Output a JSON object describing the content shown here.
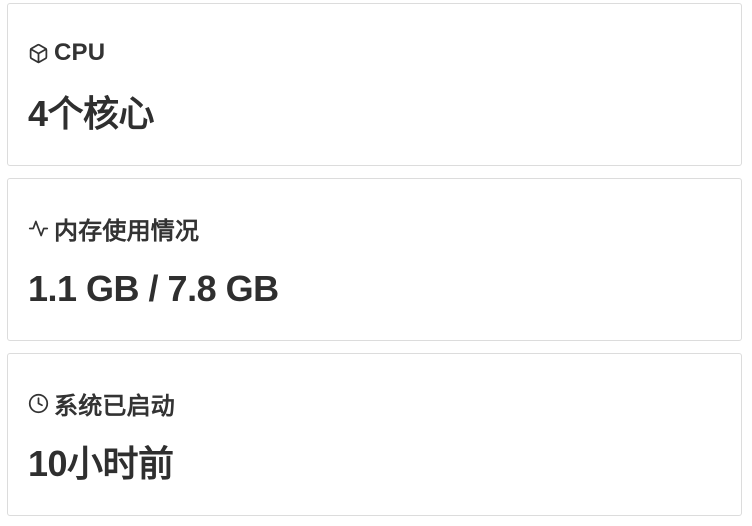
{
  "cards": [
    {
      "icon": "cube-icon",
      "label": "CPU",
      "value": "4个核心"
    },
    {
      "icon": "activity-icon",
      "label": "内存使用情况",
      "value": "1.1 GB / 7.8 GB"
    },
    {
      "icon": "clock-icon",
      "label": "系统已启动",
      "value": "10小时前"
    }
  ],
  "colors": {
    "text": "#2f2f2f",
    "border": "#dcdcdc",
    "background": "#ffffff"
  }
}
